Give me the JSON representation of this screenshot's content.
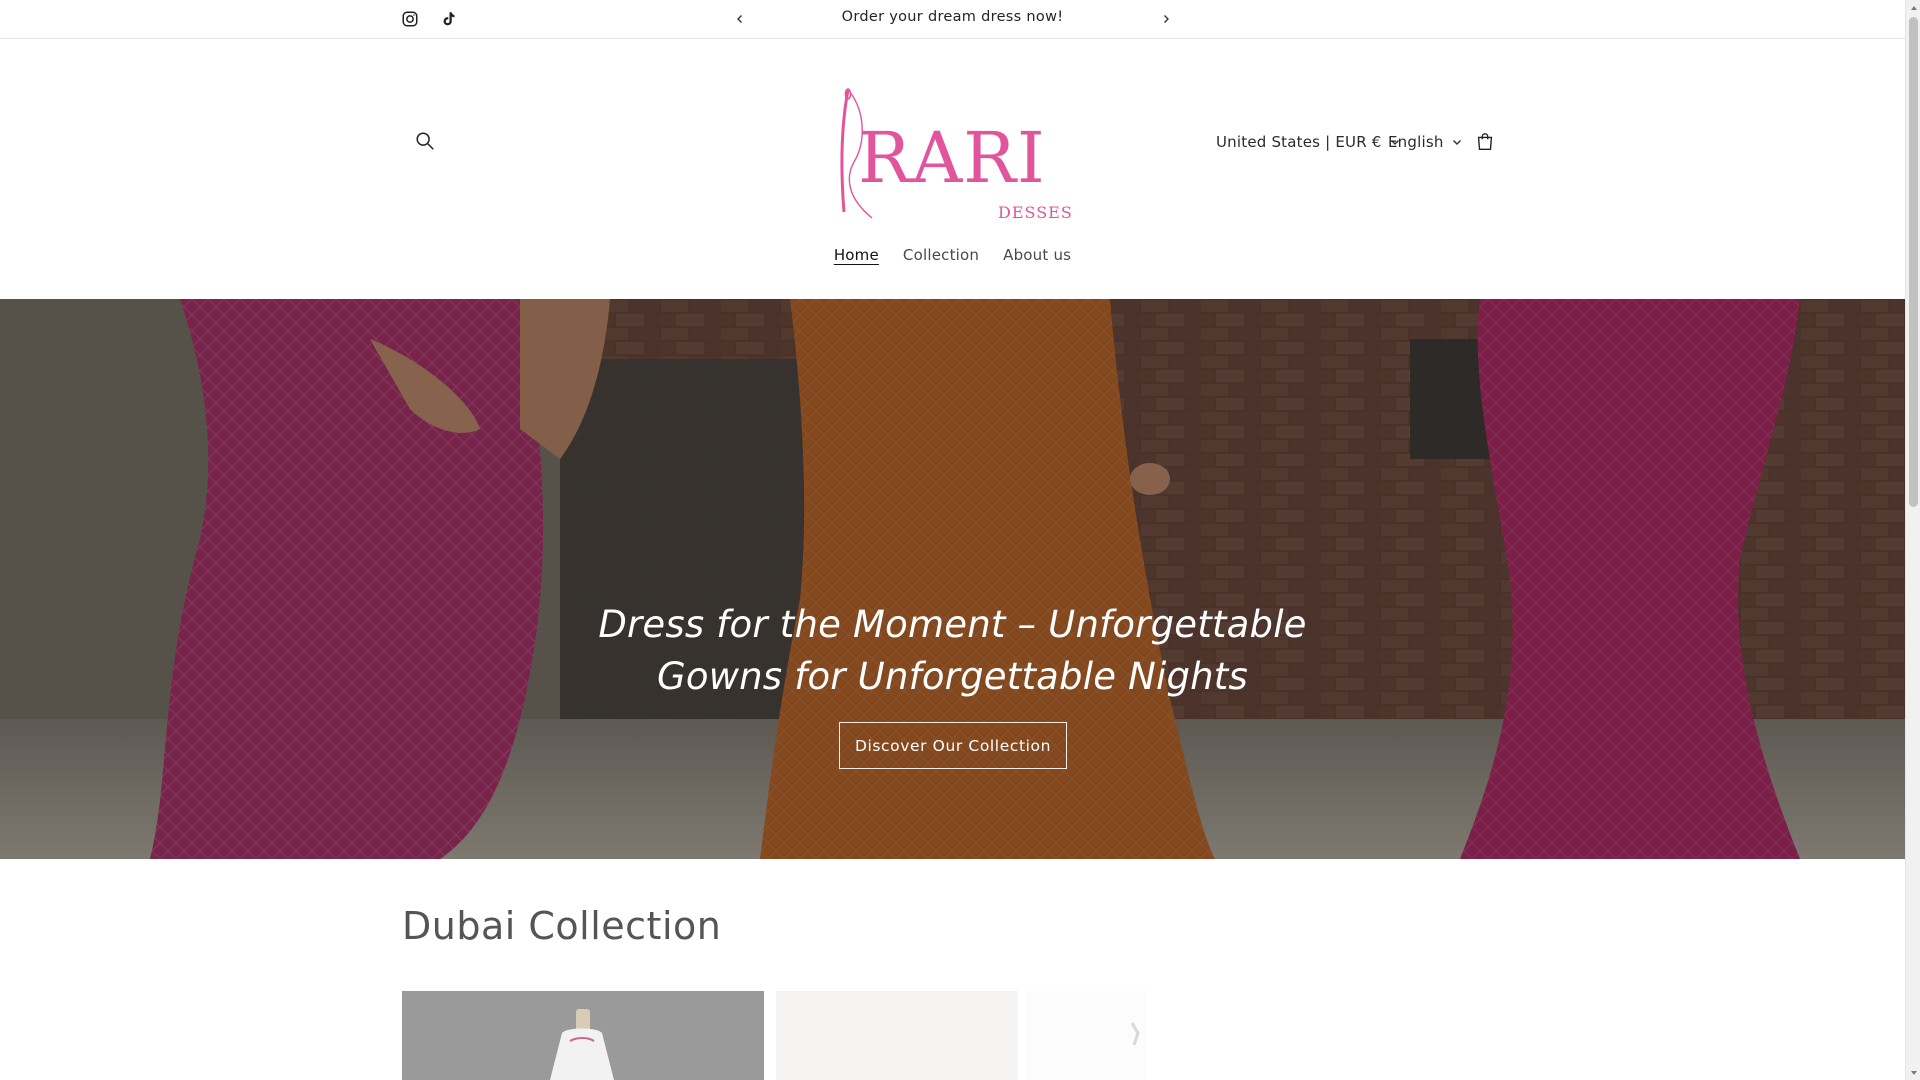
{
  "announcement": {
    "text": "Order your dream dress now!",
    "social": [
      {
        "name": "instagram-icon"
      },
      {
        "name": "tiktok-icon"
      }
    ],
    "prev_icon": "chevron-left-icon",
    "next_icon": "chevron-right-icon"
  },
  "header": {
    "logo": {
      "brand": "RARI",
      "sub": "DESSES",
      "color": "#e0559b"
    },
    "search_icon": "search-icon",
    "cart_icon": "cart-icon",
    "country_selector": "United States | EUR €",
    "language_selector": "English",
    "nav": [
      {
        "label": "Home",
        "active": true
      },
      {
        "label": "Collection",
        "active": false
      },
      {
        "label": "About us",
        "active": false
      }
    ]
  },
  "hero": {
    "heading": "Dress for the Moment – Unforgettable Gowns for Unforgettable Nights",
    "button_label": "Discover Our Collection"
  },
  "collection": {
    "title": "Dubai Collection"
  },
  "colors": {
    "brand_pink": "#e0559b",
    "text": "#121212",
    "muted": "#555555"
  }
}
